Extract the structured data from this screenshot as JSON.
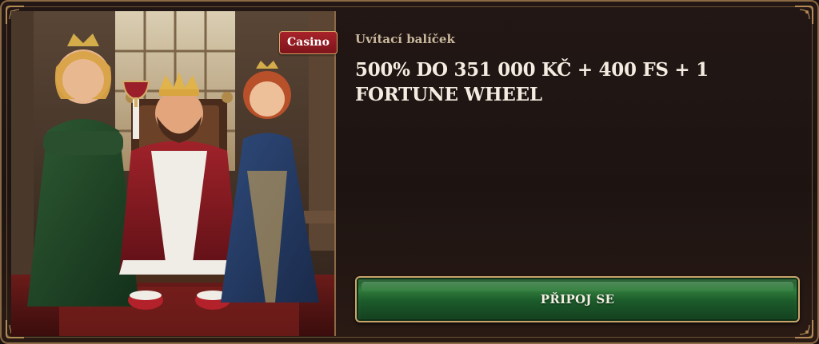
{
  "promo": {
    "badge": "Casino",
    "subtitle": "Uvítací balíček",
    "headline": "500% DO 351 000 KČ + 400 FS + 1 FORTUNE WHEEL",
    "cta_label": "PŘIPOJ SE"
  },
  "colors": {
    "frame_gold": "#8a6a44",
    "badge_red": "#a8232a",
    "cta_green": "#2f7a3a",
    "headline_text": "#f4ece0"
  },
  "illustration": {
    "description_icon": "royal-family-icon"
  }
}
